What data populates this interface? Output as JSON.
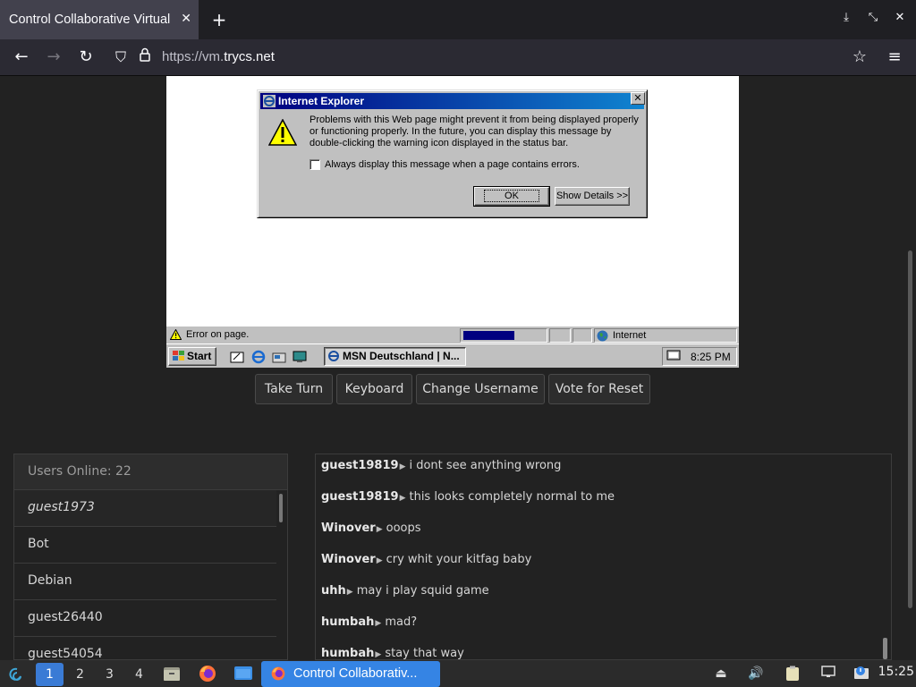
{
  "browser": {
    "tab_title": "Control Collaborative Virtual",
    "url_prefix": "https://vm.",
    "url_domain": "trycs.net"
  },
  "vm": {
    "dialog": {
      "title": "Internet Explorer",
      "message": "Problems with this Web page might prevent it from being displayed properly or functioning properly. In the future, you can display this message by double-clicking the warning icon displayed in the status bar.",
      "checkbox_label": "Always display this message when a page contains errors.",
      "ok_label": "OK",
      "details_label": "Show Details >>"
    },
    "status_text": "Error on page.",
    "zone_text": "Internet",
    "start_label": "Start",
    "task_label": "MSN Deutschland | N...",
    "clock": "8:25 PM"
  },
  "controls": {
    "take_turn": "Take Turn",
    "keyboard": "Keyboard",
    "change_username": "Change Username",
    "vote_reset": "Vote for Reset"
  },
  "users": {
    "header": "Users Online: 22",
    "list": [
      "guest1973",
      "Bot",
      "Debian",
      "guest26440",
      "guest54054"
    ]
  },
  "chat": {
    "messages": [
      {
        "user": "guest19819",
        "text": "i dont see anything wrong"
      },
      {
        "user": "guest19819",
        "text": "this looks completely normal to me"
      },
      {
        "user": "Winover",
        "text": "ooops"
      },
      {
        "user": "Winover",
        "text": "cry whit your kitfag baby"
      },
      {
        "user": "uhh",
        "text": "may i play squid game"
      },
      {
        "user": "humbah",
        "text": "mad?"
      },
      {
        "user": "humbah",
        "text": "stay that way"
      }
    ]
  },
  "desktop": {
    "workspaces": [
      "1",
      "2",
      "3",
      "4"
    ],
    "task_label": "Control Collaborativ...",
    "clock": "15:25"
  }
}
